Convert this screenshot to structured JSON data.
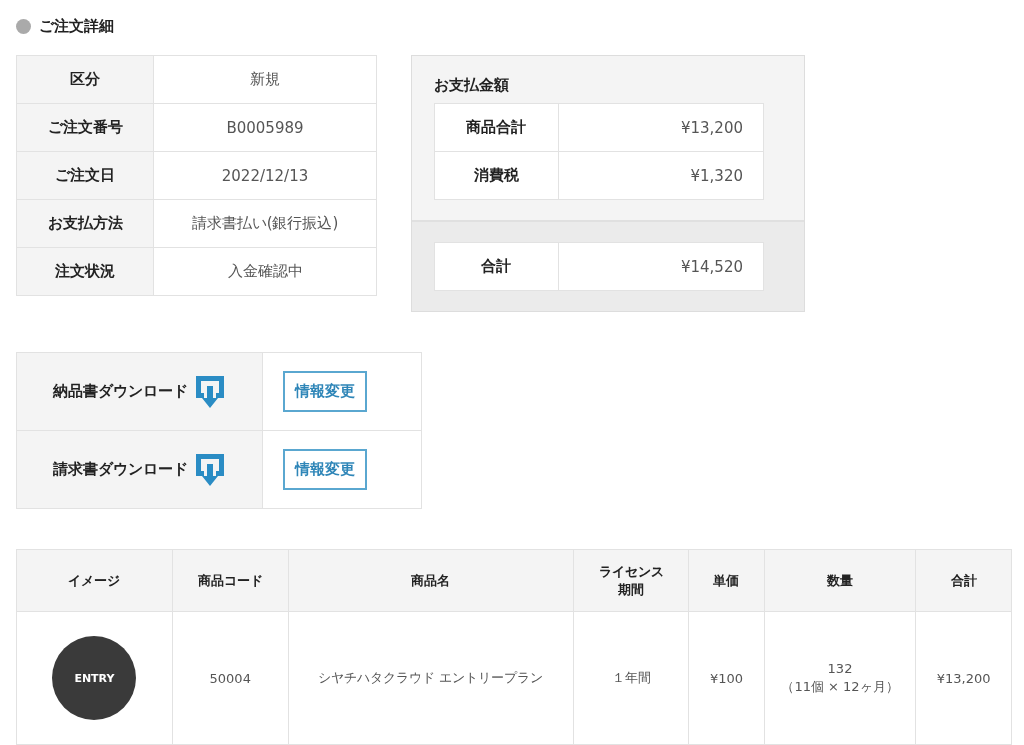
{
  "section_title": "ご注文詳細",
  "order_info": [
    {
      "label": "区分",
      "value": "新規"
    },
    {
      "label": "ご注文番号",
      "value": "B0005989"
    },
    {
      "label": "ご注文日",
      "value": "2022/12/13"
    },
    {
      "label": "お支払方法",
      "value": "請求書払い(銀行振込)"
    },
    {
      "label": "注文状況",
      "value": "入金確認中"
    }
  ],
  "payment": {
    "title": "お支払金額",
    "rows": [
      {
        "label": "商品合計",
        "value": "¥13,200"
      },
      {
        "label": "消費税",
        "value": "¥1,320"
      }
    ],
    "total": {
      "label": "合計",
      "value": "¥14,520"
    }
  },
  "downloads": [
    {
      "label": "納品書ダウンロード",
      "button": "情報変更"
    },
    {
      "label": "請求書ダウンロード",
      "button": "情報変更"
    }
  ],
  "products": {
    "columns": [
      "イメージ",
      "商品コード",
      "商品名",
      "ライセンス期間",
      "単価",
      "数量",
      "合計"
    ],
    "rows": [
      {
        "image_label": "ENTRY",
        "code": "50004",
        "name": "シヤチハタクラウド エントリープラン",
        "period": "１年間",
        "unit_price": "¥100",
        "quantity": "132",
        "quantity_detail": "（11個 × 12ヶ月）",
        "total": "¥13,200"
      }
    ]
  }
}
